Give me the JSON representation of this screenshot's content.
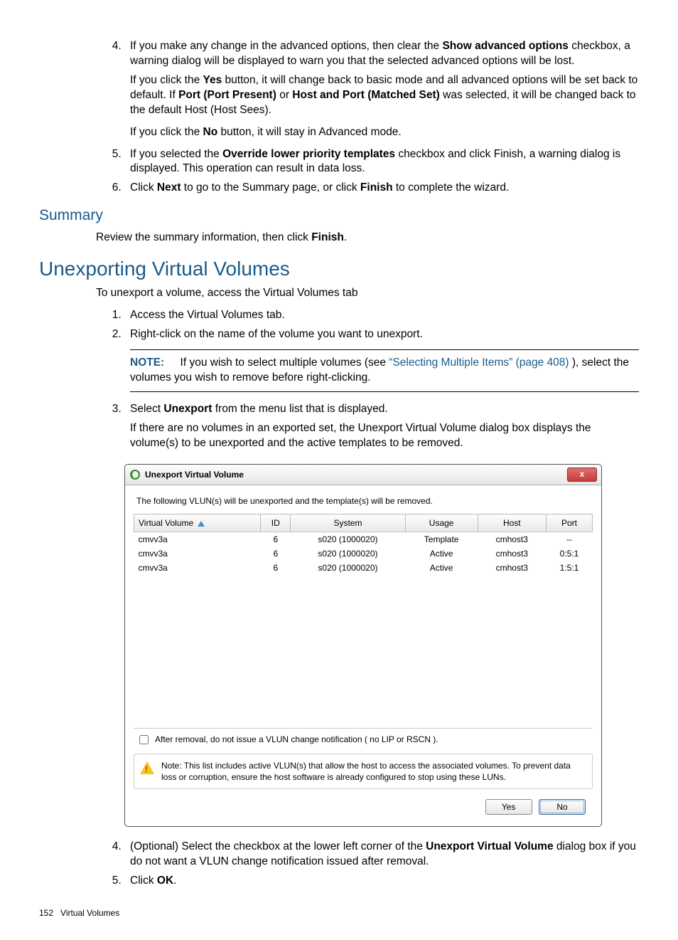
{
  "steps_a": {
    "s4_p1_a": "If you make any change in the advanced options, then clear the ",
    "s4_p1_b": "Show advanced options",
    "s4_p1_c": " checkbox, a warning dialog will be displayed to warn you that the selected advanced options will be lost.",
    "s4_p2_a": "If you click the ",
    "s4_p2_b": "Yes",
    "s4_p2_c": " button, it will change back to basic mode and all advanced options will be set back to default. If ",
    "s4_p2_d": "Port (Port Present)",
    "s4_p2_e": " or ",
    "s4_p2_f": "Host and Port (Matched Set)",
    "s4_p2_g": " was selected, it will be changed back to the default Host (Host Sees).",
    "s4_p3_a": "If you click the ",
    "s4_p3_b": "No",
    "s4_p3_c": " button, it will stay in Advanced mode.",
    "s5_a": "If you selected the ",
    "s5_b": "Override lower priority templates",
    "s5_c": " checkbox and click Finish, a warning dialog is displayed. This operation can result in data loss.",
    "s6_a": "Click ",
    "s6_b": "Next",
    "s6_c": " to go to the Summary page, or click ",
    "s6_d": "Finish",
    "s6_e": " to complete the wizard."
  },
  "summary": {
    "heading": "Summary",
    "text_a": "Review the summary information, then click ",
    "text_b": "Finish",
    "text_c": "."
  },
  "unexport": {
    "heading": "Unexporting Virtual Volumes",
    "intro": "To unexport a volume, access the Virtual Volumes tab",
    "s1": "Access the Virtual Volumes tab.",
    "s2": "Right-click on the name of the volume you want to unexport.",
    "note_label": "NOTE:",
    "note_a": "If you wish to select multiple volumes (see ",
    "note_link": "“Selecting Multiple Items” (page 408)",
    "note_b": " ), select the volumes you wish to remove before right-clicking.",
    "s3_a": "Select ",
    "s3_b": "Unexport",
    "s3_c": " from the menu list that is displayed.",
    "s3_p2": "If there are no volumes in an exported set, the Unexport Virtual Volume dialog box displays the volume(s) to be unexported and the active templates to be removed.",
    "s4_a": "(Optional) Select the checkbox at the lower left corner of the ",
    "s4_b": "Unexport Virtual Volume",
    "s4_c": " dialog box if you do not want a VLUN change notification issued after removal.",
    "s5_a": "Click ",
    "s5_b": "OK",
    "s5_c": "."
  },
  "dialog": {
    "title": "Unexport Virtual Volume",
    "close": "x",
    "msg": "The following VLUN(s) will be unexported and the template(s) will be removed.",
    "cols": [
      "Virtual Volume",
      "ID",
      "System",
      "Usage",
      "Host",
      "Port"
    ],
    "rows": [
      {
        "vol": "cmvv3a",
        "id": "6",
        "sys": "s020 (1000020)",
        "usage": "Template",
        "host": "cmhost3",
        "port": "--"
      },
      {
        "vol": "cmvv3a",
        "id": "6",
        "sys": "s020 (1000020)",
        "usage": "Active",
        "host": "cmhost3",
        "port": "0:5:1"
      },
      {
        "vol": "cmvv3a",
        "id": "6",
        "sys": "s020 (1000020)",
        "usage": "Active",
        "host": "cmhost3",
        "port": "1:5:1"
      }
    ],
    "checkbox_label": "After removal, do not issue a VLUN change notification ( no LIP or RSCN ).",
    "warn": "Note: This list includes active VLUN(s) that allow the host to access the associated volumes. To prevent data loss or corruption, ensure the host software is already configured to stop using these LUNs.",
    "yes": "Yes",
    "no": "No"
  },
  "footer": {
    "page": "152",
    "section": "Virtual Volumes"
  }
}
